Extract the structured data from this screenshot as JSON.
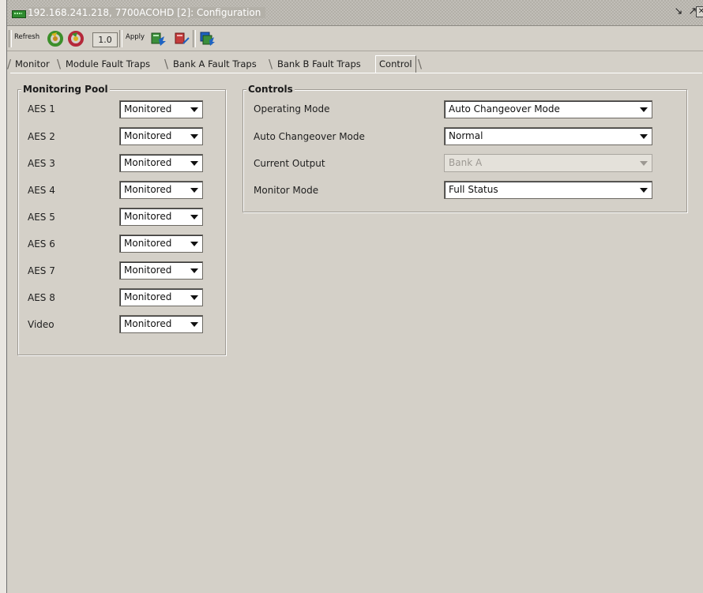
{
  "window": {
    "title": "192.168.241.218, 7700ACOHD  [2]: Configuration"
  },
  "toolbar": {
    "refresh_label": "Refresh",
    "version": "1.0",
    "apply_label": "Apply"
  },
  "tabs": [
    {
      "label": "Monitor"
    },
    {
      "label": "Module Fault Traps"
    },
    {
      "label": "Bank A Fault Traps"
    },
    {
      "label": "Bank B Fault Traps"
    },
    {
      "label": "Control",
      "active": true
    }
  ],
  "monitoring_pool": {
    "title": "Monitoring Pool",
    "rows": [
      {
        "label": "AES 1",
        "value": "Monitored"
      },
      {
        "label": "AES 2",
        "value": "Monitored"
      },
      {
        "label": "AES 3",
        "value": "Monitored"
      },
      {
        "label": "AES 4",
        "value": "Monitored"
      },
      {
        "label": "AES 5",
        "value": "Monitored"
      },
      {
        "label": "AES 6",
        "value": "Monitored"
      },
      {
        "label": "AES 7",
        "value": "Monitored"
      },
      {
        "label": "AES 8",
        "value": "Monitored"
      },
      {
        "label": "Video",
        "value": "Monitored"
      }
    ]
  },
  "controls": {
    "title": "Controls",
    "rows": [
      {
        "label": "Operating Mode",
        "value": "Auto Changeover Mode",
        "disabled": false
      },
      {
        "label": "Auto Changeover Mode",
        "value": "Normal",
        "disabled": false
      },
      {
        "label": "Current Output",
        "value": "Bank A",
        "disabled": true
      },
      {
        "label": "Monitor Mode",
        "value": "Full Status",
        "disabled": false
      }
    ]
  }
}
